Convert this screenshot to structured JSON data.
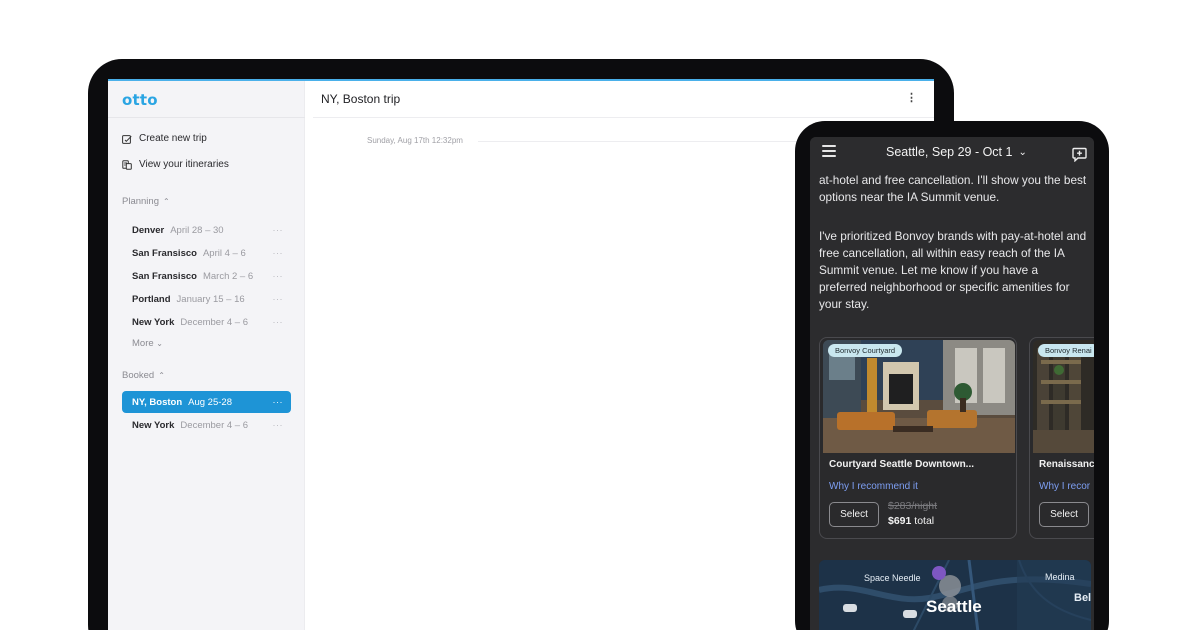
{
  "tablet": {
    "logo": "otto",
    "actions": [
      {
        "label": "Create new trip",
        "icon": "edit-square-icon"
      },
      {
        "label": "View your itineraries",
        "icon": "itinerary-icon"
      }
    ],
    "planning": {
      "header": "Planning",
      "trips": [
        {
          "name": "Denver",
          "dates": "April 28 – 30"
        },
        {
          "name": "San Fransisco",
          "dates": "April 4 – 6"
        },
        {
          "name": "San Fransisco",
          "dates": "March 2 – 6"
        },
        {
          "name": "Portland",
          "dates": "January 15 – 16"
        },
        {
          "name": "New York",
          "dates": "December 4 – 6"
        }
      ],
      "more_label": "More"
    },
    "booked": {
      "header": "Booked",
      "trips": [
        {
          "name": "NY, Boston",
          "dates": "Aug 25-28",
          "active": true
        },
        {
          "name": "New York",
          "dates": "December 4 – 6",
          "active": false
        }
      ]
    },
    "trip_dots": "···",
    "main": {
      "title": "NY, Boston trip",
      "kebab": "⋮",
      "timestamp": "Sunday, Aug 17th 12:32pm"
    },
    "accent": "#1e94d6"
  },
  "phone": {
    "header": {
      "title": "Seattle, Sep 29 - Oct 1"
    },
    "messages": [
      "at-hotel and free cancellation. I'll show you the best options near the IA Summit venue.",
      "I've prioritized Bonvoy brands with pay-at-hotel and free cancellation, all within easy reach of the IA Summit venue. Let me know if you have a preferred neighborhood or specific amenities for your stay."
    ],
    "hotels": [
      {
        "badge": "Bonvoy Courtyard",
        "name": "Courtyard Seattle Downtown...",
        "why": "Why I recommend it",
        "select": "Select",
        "nightly": "$283/night",
        "total": "$691",
        "total_suffix": "total"
      },
      {
        "badge": "Bonvoy Renai",
        "name": "Renaissanc",
        "why": "Why I recor",
        "select": "Select"
      }
    ],
    "map": {
      "labels": [
        "Space Needle",
        "Medina",
        "Seattle",
        "Bel"
      ]
    }
  }
}
